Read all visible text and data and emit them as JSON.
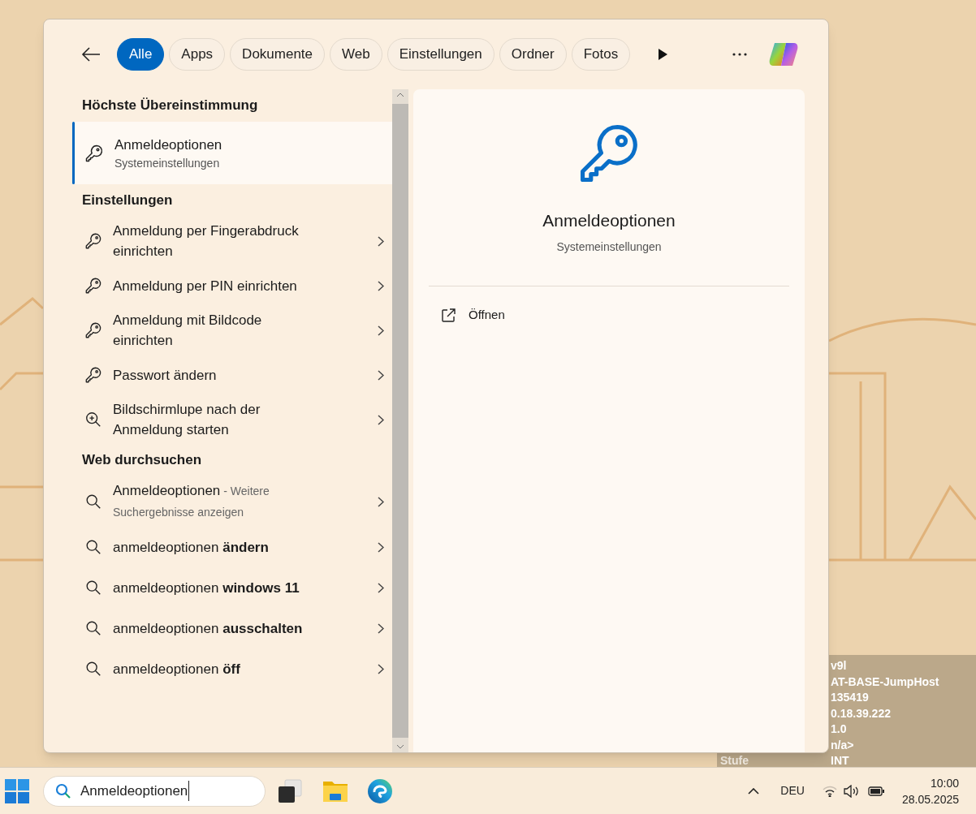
{
  "filters": [
    {
      "label": "Alle",
      "selected": true
    },
    {
      "label": "Apps",
      "selected": false
    },
    {
      "label": "Dokumente",
      "selected": false
    },
    {
      "label": "Web",
      "selected": false
    },
    {
      "label": "Einstellungen",
      "selected": false
    },
    {
      "label": "Ordner",
      "selected": false
    },
    {
      "label": "Fotos",
      "selected": false
    }
  ],
  "sections": [
    {
      "title": "Höchste Übereinstimmung",
      "items": [
        {
          "kind": "best",
          "title": "Anmeldeoptionen",
          "subtitle": "Systemeinstellungen",
          "selected": true
        }
      ]
    },
    {
      "title": "Einstellungen",
      "items": [
        {
          "kind": "key",
          "title": "Anmeldung per Fingerabdruck einrichten",
          "selected": false
        },
        {
          "kind": "key",
          "title": "Anmeldung per PIN einrichten",
          "selected": false
        },
        {
          "kind": "key",
          "title": "Anmeldung mit Bildcode einrichten",
          "selected": false
        },
        {
          "kind": "key",
          "title": "Passwort ändern",
          "selected": false
        },
        {
          "kind": "zoom",
          "title": "Bildschirmlupe nach der Anmeldung starten",
          "selected": false
        }
      ]
    },
    {
      "title": "Web durchsuchen",
      "items": [
        {
          "kind": "web",
          "title": "Anmeldeoptionen",
          "note": "- Weitere Suchergebnisse anzeigen",
          "selected": false
        },
        {
          "kind": "web",
          "title": "anmeldeoptionen **ändern**",
          "selected": false
        },
        {
          "kind": "web",
          "title": "anmeldeoptionen **windows 11**",
          "selected": false
        },
        {
          "kind": "web",
          "title": "anmeldeoptionen **ausschalten**",
          "selected": false
        },
        {
          "kind": "web",
          "title": "anmeldeoptionen **öff**",
          "selected": false
        }
      ]
    }
  ],
  "preview": {
    "title": "Anmeldeoptionen",
    "subtitle": "Systemeinstellungen",
    "actions": [
      {
        "label": "Öffnen"
      }
    ]
  },
  "info_overlay": [
    {
      "value": "v9l"
    },
    {
      "value": "AT-BASE-JumpHost"
    },
    {
      "value": "135419"
    },
    {
      "value": "0.18.39.222"
    },
    {
      "value": "1.0"
    },
    {
      "value": "n/a>"
    },
    {
      "label": "Stufe",
      "value": "INT"
    }
  ],
  "taskbar": {
    "search": {
      "value": "Anmeldeoptionen"
    },
    "language": "DEU",
    "time": "10:00",
    "date": "28.05.2025"
  }
}
